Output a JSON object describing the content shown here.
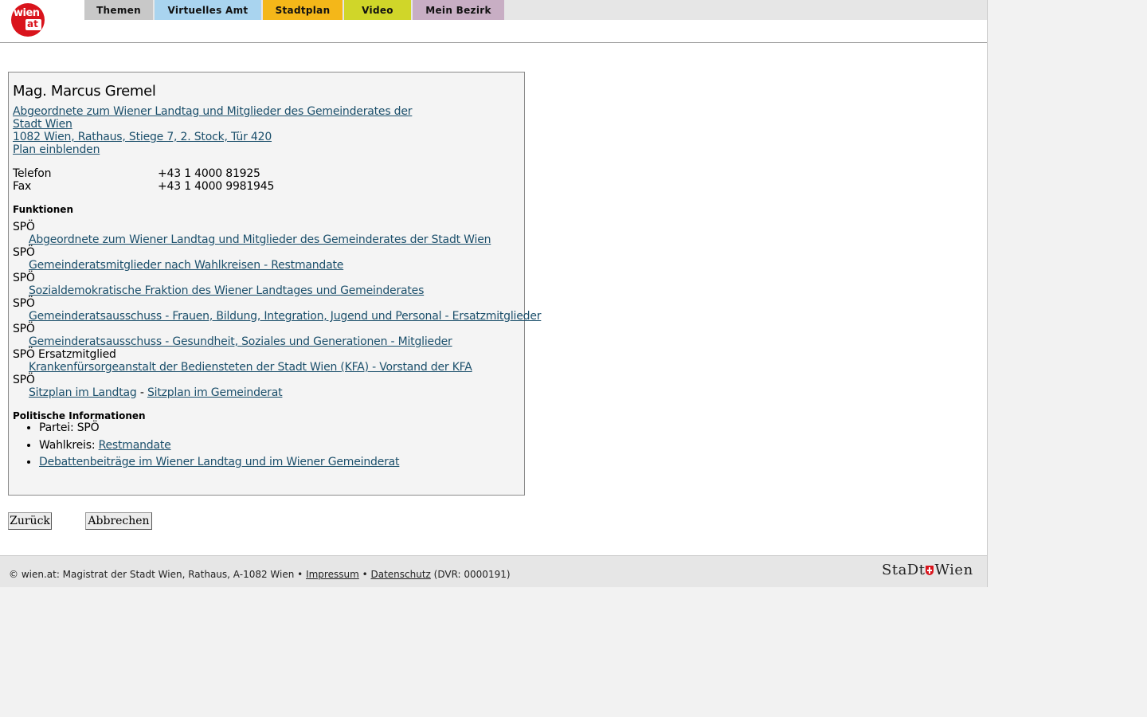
{
  "header": {
    "logo_text_top": "wien",
    "logo_text_bottom": "at",
    "tabs": [
      {
        "label": "Themen",
        "color": "#c8c8c8"
      },
      {
        "label": "Virtuelles Amt",
        "color": "#a9d4ef"
      },
      {
        "label": "Stadtplan",
        "color": "#f4b719"
      },
      {
        "label": "Video",
        "color": "#d0d629"
      },
      {
        "label": "Mein Bezirk",
        "color": "#c8aec4"
      }
    ]
  },
  "contact": {
    "name": "Mag. Marcus Gremel",
    "org_line1": "Abgeordnete zum Wiener Landtag und Mitglieder des Gemeinderates der",
    "org_line2": "Stadt Wien ",
    "address": "1082 Wien, Rathaus, Stiege 7, 2. Stock, Tür 420",
    "map_link": "Plan einblenden",
    "phone_label": "Telefon",
    "phone_value": "+43 1 4000 81925",
    "fax_label": "Fax",
    "fax_value": "+43 1 4000 9981945"
  },
  "functions": {
    "heading": "Funktionen",
    "items": [
      {
        "party": "SPÖ",
        "link": "Abgeordnete zum Wiener Landtag und Mitglieder des Gemeinderates der Stadt Wien"
      },
      {
        "party": "SPÖ",
        "link": "Gemeinderatsmitglieder nach Wahlkreisen - Restmandate"
      },
      {
        "party": "SPÖ",
        "link": "Sozialdemokratische Fraktion des Wiener Landtages und Gemeinderates"
      },
      {
        "party": "SPÖ",
        "link": "Gemeinderatsausschuss - Frauen, Bildung, Integration, Jugend und Personal - Ersatzmitglieder"
      },
      {
        "party": "SPÖ",
        "link": "Gemeinderatsausschuss - Gesundheit, Soziales und Generationen - Mitglieder"
      },
      {
        "party": "SPÖ Ersatzmitglied",
        "link": "Krankenfürsorgeanstalt der Bediensteten der Stadt Wien (KFA) - Vorstand der KFA"
      }
    ],
    "last_party": "SPÖ",
    "sitzplan_landtag": "Sitzplan im Landtag",
    "separator": " - ",
    "sitzplan_gemeinderat": "Sitzplan im Gemeinderat"
  },
  "political": {
    "heading": "Politische Informationen",
    "partei_label": "Partei: SPÖ",
    "wahlkreis_label": "Wahlkreis: ",
    "wahlkreis_link": "Restmandate",
    "debatten_link": "Debattenbeiträge im Wiener Landtag und im Wiener Gemeinderat"
  },
  "buttons": {
    "back": "Zurück",
    "cancel": "Abbrechen"
  },
  "footer": {
    "copyright": "© wien.at: Magistrat der Stadt Wien, Rathaus, A-1082 Wien • ",
    "impressum": "Impressum",
    "bullet": " • ",
    "datenschutz": "Datenschutz",
    "dvr": " (DVR: 0000191)",
    "logo_left": "StaDt",
    "logo_right": "Wien"
  }
}
